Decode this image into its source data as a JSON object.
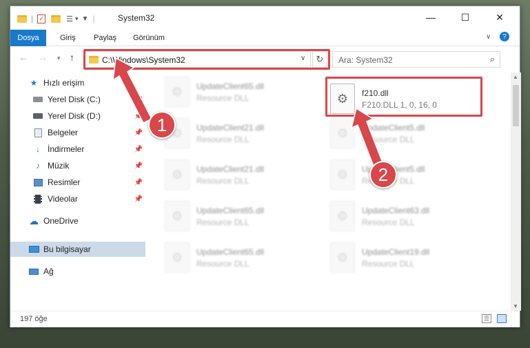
{
  "window": {
    "title": "System32",
    "controls": {
      "minimize": "—",
      "maximize": "☐",
      "close": "✕"
    }
  },
  "ribbon": {
    "tabs": [
      {
        "label": "Dosya",
        "active": true
      },
      {
        "label": "Giriş",
        "active": false
      },
      {
        "label": "Paylaş",
        "active": false
      },
      {
        "label": "Görünüm",
        "active": false
      }
    ]
  },
  "nav": {
    "address": "C:\\Windows\\System32",
    "search_placeholder": "Ara: System32"
  },
  "sidebar": {
    "items": [
      {
        "label": "Hızlı erişim",
        "icon": "star-icon"
      },
      {
        "label": "Yerel Disk (C:)",
        "icon": "drive-icon"
      },
      {
        "label": "Yerel Disk (D:)",
        "icon": "drive-icon"
      },
      {
        "label": "Belgeler",
        "icon": "documents-icon"
      },
      {
        "label": "İndirmeler",
        "icon": "download-icon"
      },
      {
        "label": "Müzik",
        "icon": "music-icon"
      },
      {
        "label": "Resimler",
        "icon": "pictures-icon"
      },
      {
        "label": "Videolar",
        "icon": "videos-icon"
      },
      {
        "label": "OneDrive",
        "icon": "cloud-icon"
      },
      {
        "label": "Bu bilgisayar",
        "icon": "computer-icon"
      },
      {
        "label": "Ağ",
        "icon": "network-icon"
      }
    ]
  },
  "files": {
    "highlight": {
      "name": "f210.dll",
      "desc": "F210.DLL 1, 0, 16, 0"
    },
    "left_column": [
      {
        "name": "UpdateClient65.dll",
        "desc": "Resource DLL"
      },
      {
        "name": "UpdateClient21.dll",
        "desc": "Resource DLL"
      },
      {
        "name": "UpdateClient21.dll",
        "desc": "Resource DLL"
      },
      {
        "name": "UpdateClient65.dll",
        "desc": "Resource DLL"
      },
      {
        "name": "UpdateClient65.dll",
        "desc": "Resource DLL"
      }
    ],
    "right_column": [
      {
        "name": "UpdateClient5.dll",
        "desc": "Resource DLL"
      },
      {
        "name": "UpdateClient5.dll",
        "desc": "Resource DLL"
      },
      {
        "name": "UpdateClient63.dll",
        "desc": "Resource DLL"
      },
      {
        "name": "UpdateClient19.dll",
        "desc": "Resource DLL"
      }
    ]
  },
  "status": {
    "count": "197 öğe"
  },
  "annotations": {
    "step1": "1",
    "step2": "2"
  },
  "colors": {
    "accent": "#1979ca",
    "annotation": "#d9464b"
  }
}
